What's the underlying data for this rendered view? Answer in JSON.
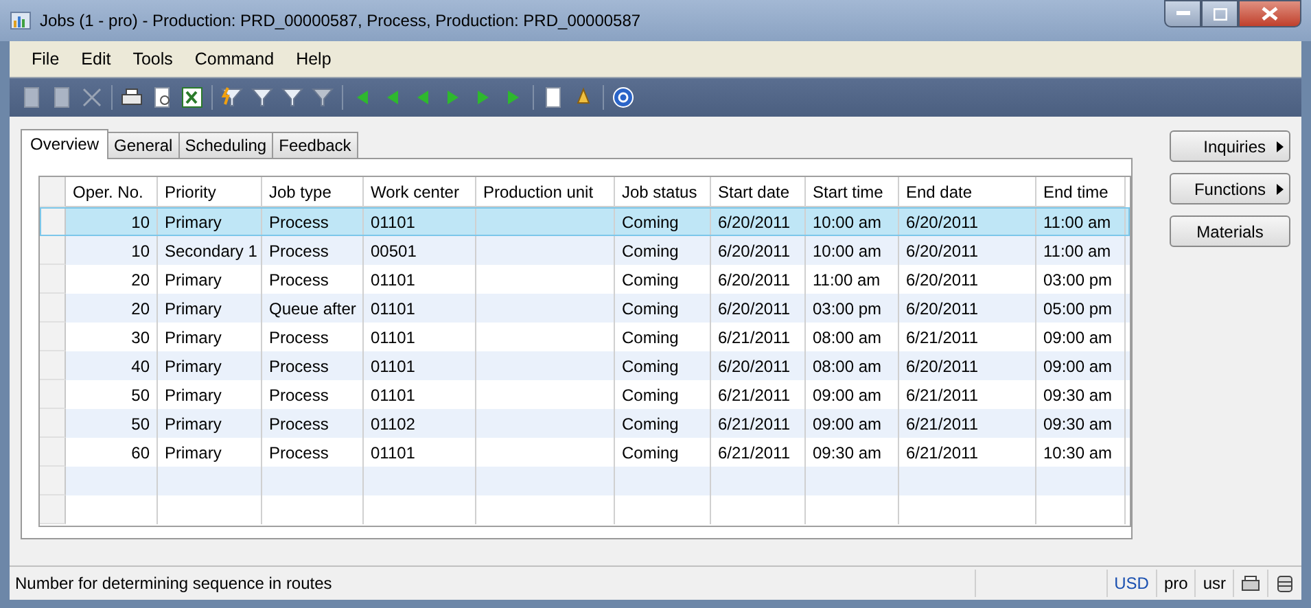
{
  "window": {
    "title": "Jobs (1 - pro) - Production: PRD_00000587, Process, Production: PRD_00000587"
  },
  "menu": [
    "File",
    "Edit",
    "Tools",
    "Command",
    "Help"
  ],
  "tabs": [
    {
      "label": "Overview",
      "selected": true
    },
    {
      "label": "General",
      "selected": false
    },
    {
      "label": "Scheduling",
      "selected": false
    },
    {
      "label": "Feedback",
      "selected": false
    }
  ],
  "table": {
    "columns": [
      "Oper. No.",
      "Priority",
      "Job type",
      "Work center",
      "Production unit",
      "Job status",
      "Start date",
      "Start time",
      "End date",
      "End time"
    ],
    "rows": [
      {
        "selected": true,
        "cells": [
          "10",
          "Primary",
          "Process",
          "01101",
          "",
          "Coming",
          "6/20/2011",
          "10:00 am",
          "6/20/2011",
          "11:00 am"
        ]
      },
      {
        "selected": false,
        "cells": [
          "10",
          "Secondary 1",
          "Process",
          "00501",
          "",
          "Coming",
          "6/20/2011",
          "10:00 am",
          "6/20/2011",
          "11:00 am"
        ]
      },
      {
        "selected": false,
        "cells": [
          "20",
          "Primary",
          "Process",
          "01101",
          "",
          "Coming",
          "6/20/2011",
          "11:00 am",
          "6/20/2011",
          "03:00 pm"
        ]
      },
      {
        "selected": false,
        "cells": [
          "20",
          "Primary",
          "Queue after",
          "01101",
          "",
          "Coming",
          "6/20/2011",
          "03:00 pm",
          "6/20/2011",
          "05:00 pm"
        ]
      },
      {
        "selected": false,
        "cells": [
          "30",
          "Primary",
          "Process",
          "01101",
          "",
          "Coming",
          "6/21/2011",
          "08:00 am",
          "6/21/2011",
          "09:00 am"
        ]
      },
      {
        "selected": false,
        "cells": [
          "40",
          "Primary",
          "Process",
          "01101",
          "",
          "Coming",
          "6/20/2011",
          "08:00 am",
          "6/20/2011",
          "09:00 am"
        ]
      },
      {
        "selected": false,
        "cells": [
          "50",
          "Primary",
          "Process",
          "01101",
          "",
          "Coming",
          "6/21/2011",
          "09:00 am",
          "6/21/2011",
          "09:30 am"
        ]
      },
      {
        "selected": false,
        "cells": [
          "50",
          "Primary",
          "Process",
          "01102",
          "",
          "Coming",
          "6/21/2011",
          "09:00 am",
          "6/21/2011",
          "09:30 am"
        ]
      },
      {
        "selected": false,
        "cells": [
          "60",
          "Primary",
          "Process",
          "01101",
          "",
          "Coming",
          "6/21/2011",
          "09:30 am",
          "6/21/2011",
          "10:30 am"
        ]
      }
    ]
  },
  "side_buttons": [
    {
      "label": "Inquiries",
      "kind": "menu"
    },
    {
      "label": "Functions",
      "kind": "menu"
    },
    {
      "label": "Materials",
      "kind": "plain"
    }
  ],
  "status_bar": {
    "text": "Number for determining sequence in routes",
    "fields": [
      "USD",
      "pro",
      "usr"
    ]
  }
}
